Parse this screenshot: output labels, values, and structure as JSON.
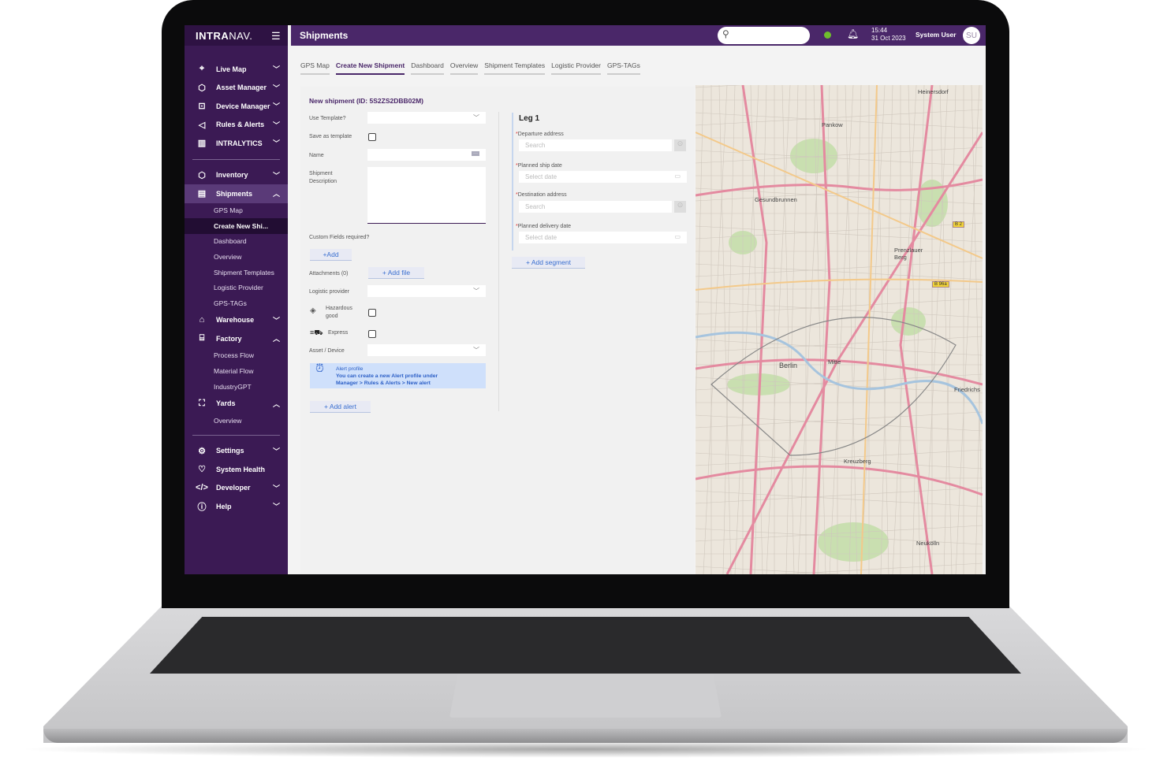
{
  "app": {
    "brand_bold": "INTRA",
    "brand_light": "NAV.",
    "page_title": "Shipments"
  },
  "header": {
    "time": "15:44",
    "date": "31 Oct 2023",
    "user": "System User",
    "avatar": "SU",
    "status_color": "#6fbe2d"
  },
  "sidebar": {
    "group1": [
      {
        "label": "Live Map",
        "icon": "map-pin-icon"
      },
      {
        "label": "Asset Manager",
        "icon": "cube-plus-icon"
      },
      {
        "label": "Device Manager",
        "icon": "chip-icon"
      },
      {
        "label": "Rules & Alerts",
        "icon": "megaphone-icon"
      },
      {
        "label": "INTRALYTICS",
        "icon": "bar-chart-icon"
      }
    ],
    "inventory": "Inventory",
    "shipments": "Shipments",
    "shipments_sub": [
      "GPS Map",
      "Create New Shi...",
      "Dashboard",
      "Overview",
      "Shipment Templates",
      "Logistic Provider",
      "GPS-TAGs"
    ],
    "warehouse": "Warehouse",
    "factory": "Factory",
    "factory_sub": [
      "Process Flow",
      "Material Flow",
      "IndustryGPT"
    ],
    "yards": "Yards",
    "yards_sub": [
      "Overview"
    ],
    "group3": [
      {
        "label": "Settings",
        "icon": "gear-icon"
      },
      {
        "label": "System Health",
        "icon": "heart-icon"
      },
      {
        "label": "Developer",
        "icon": "code-icon"
      },
      {
        "label": "Help",
        "icon": "help-icon"
      }
    ]
  },
  "tabs": [
    "GPS Map",
    "Create New Shipment",
    "Dashboard",
    "Overview",
    "Shipment Templates",
    "Logistic Provider",
    "GPS-TAGs"
  ],
  "form": {
    "heading": "New shipment (ID: 5S2ZS2DBB02M)",
    "use_template": "Use Template?",
    "save_template": "Save as template",
    "name": "Name",
    "description": "Shipment Description",
    "custom_fields": "Custom Fields required?",
    "add": "+Add",
    "attachments": "Attachments (0)",
    "add_file": "+ Add file",
    "logistic_provider": "Logistic provider",
    "hazardous": "Hazardous good",
    "express": "Express",
    "asset_device": "Asset / Device",
    "alert_title": "Alert profile",
    "alert_text1": "You can create a new Alert profile under",
    "alert_text2": "Manager > Rules & Alerts > New alert",
    "add_alert": "+ Add alert"
  },
  "leg": {
    "title": "Leg 1",
    "departure": "Departure address",
    "departure_ph": "Search",
    "ship_date": "Planned ship date",
    "ship_date_ph": "Select date",
    "destination": "Destination address",
    "destination_ph": "Search",
    "delivery_date": "Planned delivery date",
    "delivery_date_ph": "Select date",
    "add_segment": "+ Add segment"
  },
  "map": {
    "labels": [
      "Heinersdorf",
      "Pankow",
      "Gesundbrunnen",
      "Prenzlauer Berg",
      "Berlin",
      "Mitte",
      "Friedrichs",
      "Kreuzberg",
      "Neukölln"
    ],
    "shields": [
      "B 2",
      "B 96a"
    ]
  }
}
